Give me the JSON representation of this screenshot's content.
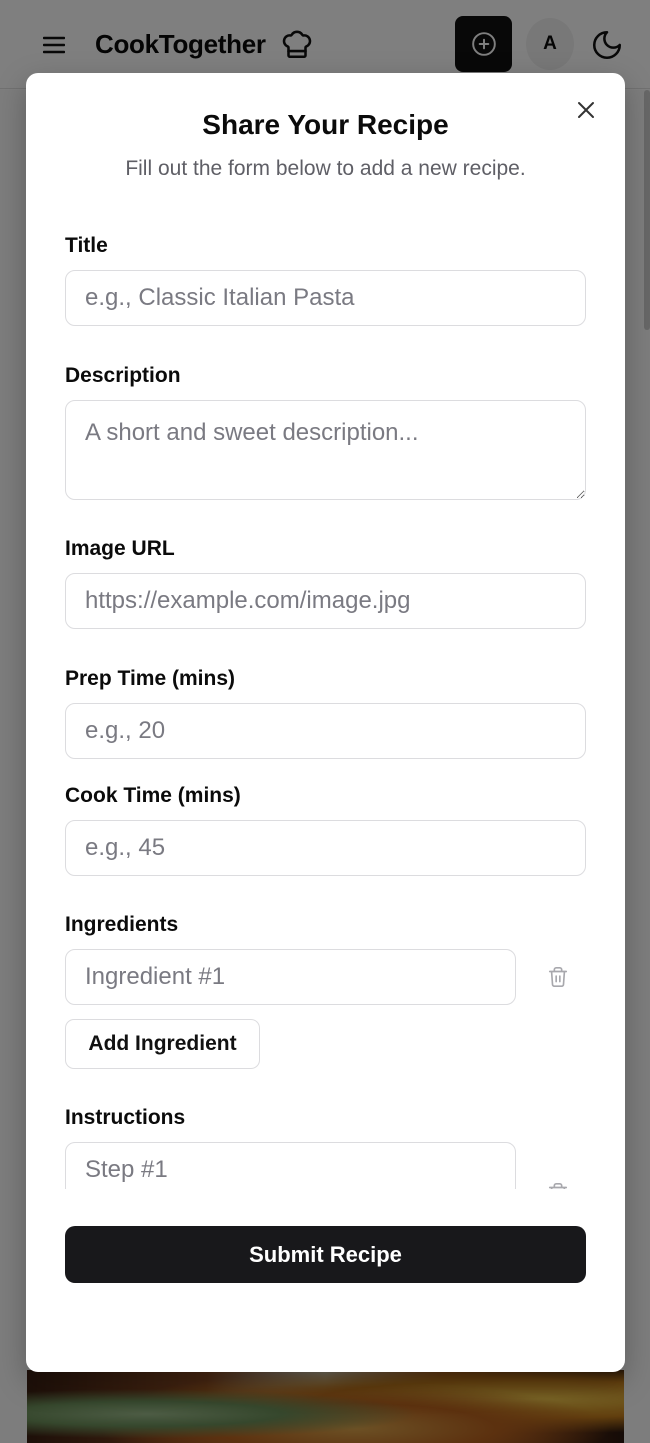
{
  "header": {
    "brand": "CookTogether",
    "avatar_initial": "A",
    "icons": [
      "menu-icon",
      "chef-hat-icon",
      "plus-circle-icon",
      "moon-icon"
    ]
  },
  "modal": {
    "title": "Share Your Recipe",
    "subtitle": "Fill out the form below to add a new recipe.",
    "fields": {
      "title": {
        "label": "Title",
        "placeholder": "e.g., Classic Italian Pasta"
      },
      "description": {
        "label": "Description",
        "placeholder": "A short and sweet description..."
      },
      "image_url": {
        "label": "Image URL",
        "placeholder": "https://example.com/image.jpg"
      },
      "prep_time": {
        "label": "Prep Time (mins)",
        "placeholder": "e.g., 20"
      },
      "cook_time": {
        "label": "Cook Time (mins)",
        "placeholder": "e.g., 45"
      }
    },
    "ingredients": {
      "label": "Ingredients",
      "items": [
        {
          "placeholder": "Ingredient #1"
        }
      ],
      "add_label": "Add Ingredient"
    },
    "instructions": {
      "label": "Instructions",
      "items": [
        {
          "placeholder": "Step #1"
        }
      ]
    },
    "submit_label": "Submit Recipe"
  }
}
